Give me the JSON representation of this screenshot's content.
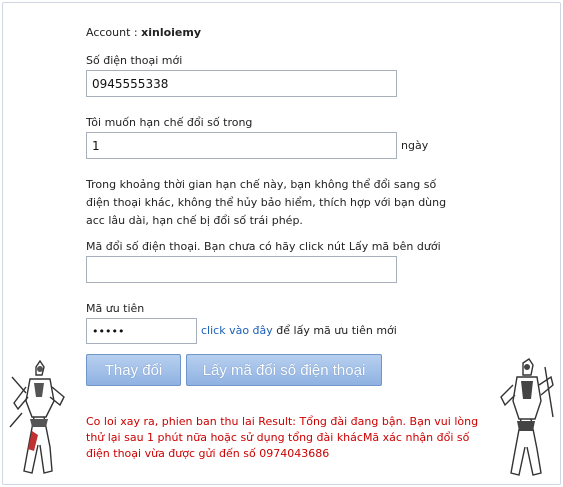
{
  "account": {
    "label": "Account : ",
    "name": "xinloiemy"
  },
  "phone": {
    "label": "Số điện thoại mới",
    "value": "0945555338"
  },
  "limit": {
    "label": "Tôi muốn hạn chế đổi số trong",
    "value": "1",
    "unit": "ngày"
  },
  "description": "Trong khoảng thời gian hạn chế này, bạn không thể đổi sang số điện thoại khác, không thể hủy bảo hiểm, thích hợp với bạn dùng acc lâu dài, hạn chế bị đổi số trái phép.",
  "change_code": {
    "label": "Mã đổi số điện thoại. Bạn chưa có hãy click nút Lấy mã bên dưới",
    "value": ""
  },
  "priority": {
    "label": "Mã ưu tiên",
    "value": "•••••",
    "link_text": "click vào đây",
    "link_suffix": " để lấy mã ưu tiên mới"
  },
  "buttons": {
    "change": "Thay đổi",
    "get_code": "Lấy mã đổi số điện thoại"
  },
  "error_message": "Co loi xay ra, phien ban thu lai Result: Tổng đài đang bận. Bạn vui lòng thử lại sau 1 phút nữa hoặc sử dụng tổng đài khácMã xác nhận đổi số điện thoại vừa được gửi đến số 0974043686",
  "colors": {
    "button": "#8fb2e2",
    "link": "#1a5fb4",
    "error": "#cc0000",
    "border": "#a8b0bc"
  }
}
